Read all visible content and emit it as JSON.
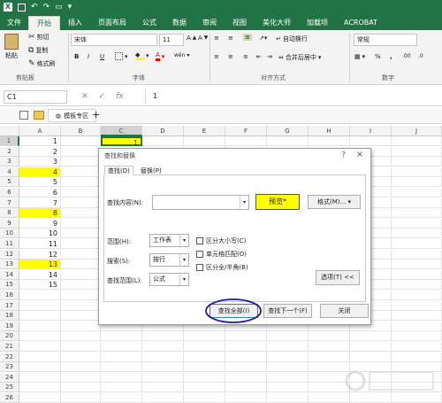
{
  "qat": {
    "save_icon": "save-icon",
    "undo_icon": "undo-icon",
    "redo_icon": "redo-icon"
  },
  "tabs": [
    "文件",
    "开始",
    "插入",
    "页面布局",
    "公式",
    "数据",
    "审阅",
    "视图",
    "美化大师",
    "加载项",
    "ACROBAT"
  ],
  "ribbon": {
    "paste": "粘贴",
    "cut": "剪切",
    "copy": "复制",
    "format_painter": "格式刷",
    "clipboard": "剪贴板",
    "font_name": "宋体",
    "font_size": "11",
    "bold": "B",
    "italic": "I",
    "underline": "U",
    "font_color_glyph": "A",
    "wen": "wén",
    "font_group": "字体",
    "wrap_text": "自动换行",
    "merge_center": "合并后居中",
    "alignment_group": "对齐方式",
    "number_format": "常规",
    "percent": "%",
    "comma": ",",
    "number_group": "数字"
  },
  "formula_bar": {
    "name_box": "C1",
    "fx": "fx",
    "value": "1"
  },
  "doc_tabs": {
    "template_tab": "模板专区",
    "add": "+"
  },
  "columns": [
    "A",
    "B",
    "C",
    "D",
    "E",
    "F",
    "G",
    "H",
    "I",
    "J"
  ],
  "rows": [
    {
      "n": "1",
      "a": "1",
      "c": "1"
    },
    {
      "n": "2",
      "a": "2"
    },
    {
      "n": "3",
      "a": "3"
    },
    {
      "n": "4",
      "a": "4"
    },
    {
      "n": "5",
      "a": "5"
    },
    {
      "n": "6",
      "a": "6"
    },
    {
      "n": "7",
      "a": "7"
    },
    {
      "n": "8",
      "a": "8"
    },
    {
      "n": "9",
      "a": "9"
    },
    {
      "n": "10",
      "a": "10"
    },
    {
      "n": "11",
      "a": "11"
    },
    {
      "n": "12",
      "a": "12"
    },
    {
      "n": "13",
      "a": "13"
    },
    {
      "n": "14",
      "a": "14"
    },
    {
      "n": "15",
      "a": "15"
    },
    {
      "n": "16"
    },
    {
      "n": "17"
    },
    {
      "n": "18"
    },
    {
      "n": "19"
    },
    {
      "n": "20"
    },
    {
      "n": "21"
    },
    {
      "n": "22"
    },
    {
      "n": "23"
    },
    {
      "n": "24"
    },
    {
      "n": "25"
    },
    {
      "n": "26"
    }
  ],
  "highlight_color": "#ffff00",
  "dialog": {
    "title": "查找和替换",
    "help": "?",
    "close": "×",
    "tab_find": "查找(D)",
    "tab_replace": "替换(P)",
    "find_what_label": "查找内容(N):",
    "find_what_value": "",
    "preview": "预览*",
    "format": "格式(M)...",
    "within_label": "范围(H):",
    "within_value": "工作表",
    "search_label": "搜索(S):",
    "search_value": "按行",
    "look_in_label": "查找范围(L):",
    "look_in_value": "公式",
    "match_case": "区分大小写(C)",
    "match_entire": "单元格匹配(O)",
    "match_byte": "区分全/半角(B)",
    "options": "选项(T) <<",
    "find_all": "查找全部(I)",
    "find_next": "查找下一个(F)",
    "close_btn": "关闭"
  }
}
